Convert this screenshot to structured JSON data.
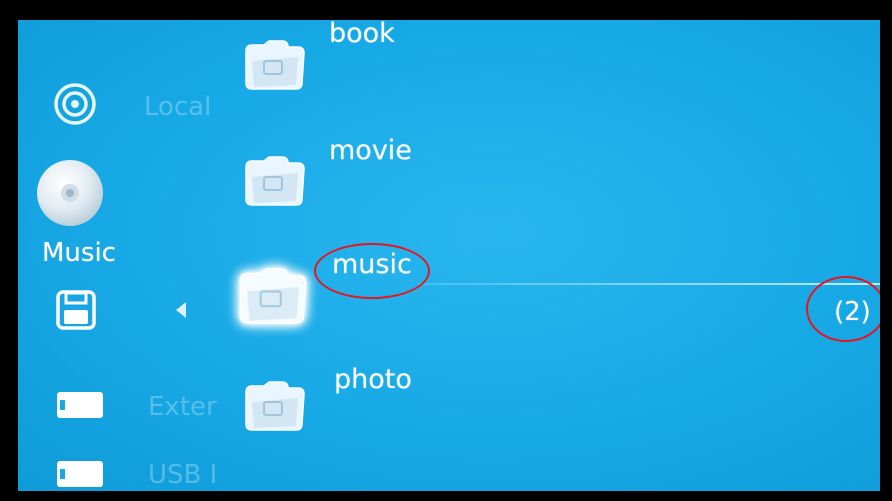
{
  "sidebar": {
    "local_label": "Local",
    "music_label": "Music",
    "external_label": "Exter",
    "usb_label": "USB I"
  },
  "folders": [
    {
      "label": "book"
    },
    {
      "label": "movie"
    },
    {
      "label": "music"
    },
    {
      "label": "photo"
    }
  ],
  "count_label": "(2)",
  "colors": {
    "background": "#17a9e6",
    "highlight_ring": "#e5161f",
    "text": "#ffffff"
  },
  "icons": {
    "local": "disc-ring-icon",
    "music": "cd-icon",
    "save": "floppy-icon",
    "back": "left-arrow-icon",
    "external": "card-icon",
    "usb": "usb-icon",
    "folder": "folder-icon"
  }
}
